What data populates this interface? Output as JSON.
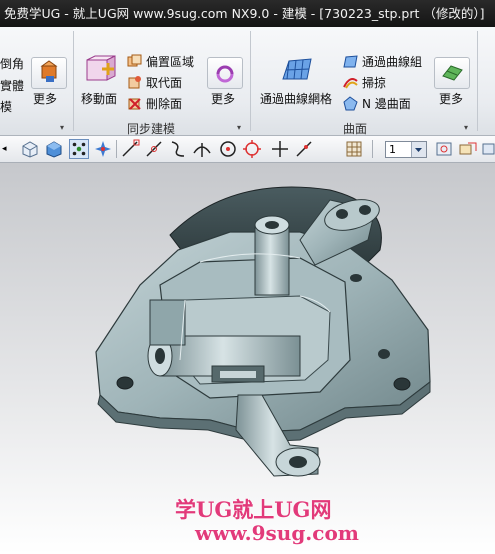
{
  "window": {
    "title": "免费学UG - 就上UG网 www.9sug.com NX9.0 - 建模 - [730223_stp.prt （修改的）]"
  },
  "ribbon": {
    "left_partial": {
      "line1": "倒角",
      "line2": "實體",
      "line3": "模"
    },
    "more_label": "更多",
    "sync_group": {
      "move_face_label": "移動面",
      "offset_region_label": "偏置區域",
      "replace_face_label": "取代面",
      "delete_face_label": "刪除面",
      "group_label": "同步建模"
    },
    "surface_group": {
      "mesh_label": "通過曲線網格",
      "through_curves_label": "通過曲線組",
      "sweep_label": "掃掠",
      "n_sided_label": "N 邊曲面",
      "group_label": "曲面"
    }
  },
  "toolbar": {
    "layer_value": "1"
  },
  "watermark": {
    "line1": "学UG就上UG网",
    "line2": "www.9sug.com"
  },
  "colors": {
    "model": "#9fb4b8",
    "model_dark": "#5f7478",
    "watermark": "#e23a7a"
  }
}
